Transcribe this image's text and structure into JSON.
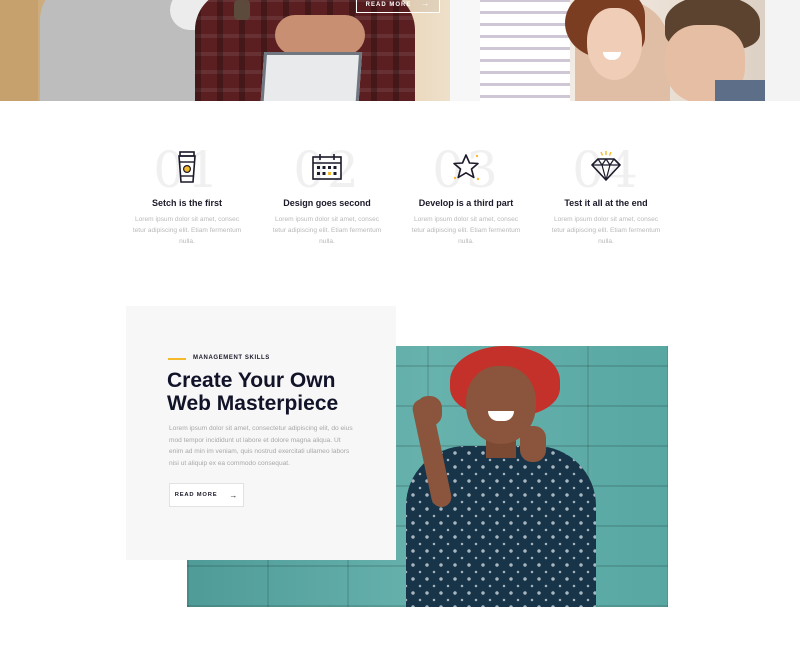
{
  "hero": {
    "button_label": "READ MORE",
    "button_arrow": "→"
  },
  "steps": [
    {
      "number": "01",
      "icon": "coffee-cup-icon",
      "title": "Setch is the first",
      "text": "Lorem ipsum dolor sit amet, consec tetur adipiscing elit. Etiam fermentum nulla."
    },
    {
      "number": "02",
      "icon": "calendar-icon",
      "title": "Design goes second",
      "text": "Lorem ipsum dolor sit amet, consec tetur adipiscing elit. Etiam fermentum nulla."
    },
    {
      "number": "03",
      "icon": "star-icon",
      "title": "Develop is a third part",
      "text": "Lorem ipsum dolor sit amet, consec tetur adipiscing elit. Etiam fermentum nulla."
    },
    {
      "number": "04",
      "icon": "diamond-icon",
      "title": "Test it all at the end",
      "text": "Lorem ipsum dolor sit amet, consec tetur adipiscing elit. Etiam fermentum nulla."
    }
  ],
  "feature": {
    "kicker": "MANAGEMENT SKILLS",
    "heading": "Create Your Own Web Masterpiece",
    "body": "Lorem ipsum dolor sit amet, consectetur adipiscing elit, do eius mod tempor incididunt ut labore et dolore magna aliqua. Ut enim ad min im veniam, quis nostrud exercitati ullameo labors nisi ut aliquip ex ea commodo consequat.",
    "button_label": "READ MORE",
    "button_arrow": "→"
  },
  "colors": {
    "accent": "#f5b92c",
    "heading": "#111328",
    "card_bg": "#f7f7f7"
  }
}
